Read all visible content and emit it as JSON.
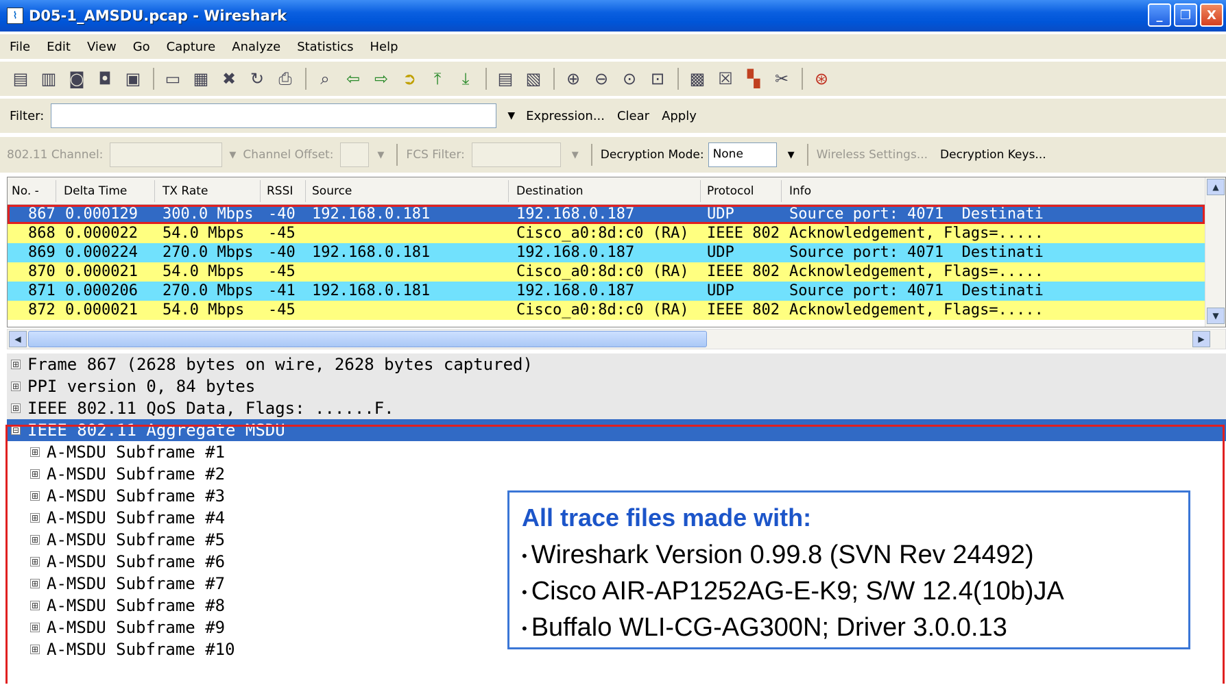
{
  "window": {
    "title": "D05-1_AMSDU.pcap - Wireshark",
    "minimize_glyph": "_",
    "maximize_glyph": "❐",
    "close_glyph": "X"
  },
  "menu": [
    "File",
    "Edit",
    "View",
    "Go",
    "Capture",
    "Analyze",
    "Statistics",
    "Help"
  ],
  "toolbar": {
    "icons": [
      "interface-list-icon",
      "capture-options-icon",
      "start-capture-icon",
      "stop-capture-icon",
      "restart-capture-icon",
      "open-file-icon",
      "save-file-icon",
      "close-file-icon",
      "reload-icon",
      "print-icon",
      "find-packet-icon",
      "go-back-icon",
      "go-forward-icon",
      "go-to-packet-icon",
      "go-first-icon",
      "go-last-icon",
      "colorize-icon",
      "auto-scroll-icon",
      "zoom-in-icon",
      "zoom-out-icon",
      "zoom-normal-icon",
      "resize-columns-icon",
      "capture-filters-icon",
      "display-filters-icon",
      "coloring-rules-icon",
      "preferences-icon",
      "help-icon"
    ]
  },
  "filter": {
    "label": "Filter:",
    "value": "",
    "expression": "Expression...",
    "clear": "Clear",
    "apply": "Apply"
  },
  "wireless": {
    "channel_label": "802.11 Channel:",
    "offset_label": "Channel Offset:",
    "fcs_label": "FCS Filter:",
    "decryption_label": "Decryption Mode:",
    "decryption_value": "None",
    "settings": "Wireless Settings...",
    "keys": "Decryption Keys..."
  },
  "packet_list": {
    "columns": [
      "No. -",
      "Delta Time",
      "TX Rate",
      "RSSI",
      "Source",
      "Destination",
      "Protocol",
      "Info"
    ],
    "rows": [
      {
        "no": "867",
        "delta": "0.000129",
        "rate": "300.0 Mbps",
        "rssi": "-40",
        "src": "192.168.0.181",
        "dst": "192.168.0.187",
        "proto": "UDP",
        "info": "Source port: 4071  Destinati",
        "style": "selected"
      },
      {
        "no": "868",
        "delta": "0.000022",
        "rate": "54.0 Mbps",
        "rssi": "-45",
        "src": "",
        "dst": "Cisco_a0:8d:c0 (RA)",
        "proto": "IEEE 802",
        "info": "Acknowledgement, Flags=.....",
        "style": "yellow"
      },
      {
        "no": "869",
        "delta": "0.000224",
        "rate": "270.0 Mbps",
        "rssi": "-40",
        "src": "192.168.0.181",
        "dst": "192.168.0.187",
        "proto": "UDP",
        "info": "Source port: 4071  Destinati",
        "style": "cyan"
      },
      {
        "no": "870",
        "delta": "0.000021",
        "rate": "54.0 Mbps",
        "rssi": "-45",
        "src": "",
        "dst": "Cisco_a0:8d:c0 (RA)",
        "proto": "IEEE 802",
        "info": "Acknowledgement, Flags=.....",
        "style": "yellow"
      },
      {
        "no": "871",
        "delta": "0.000206",
        "rate": "270.0 Mbps",
        "rssi": "-41",
        "src": "192.168.0.181",
        "dst": "192.168.0.187",
        "proto": "UDP",
        "info": "Source port: 4071  Destinati",
        "style": "cyan"
      },
      {
        "no": "872",
        "delta": "0.000021",
        "rate": "54.0 Mbps",
        "rssi": "-45",
        "src": "",
        "dst": "Cisco_a0:8d:c0 (RA)",
        "proto": "IEEE 802",
        "info": "Acknowledgement, Flags=.....",
        "style": "yellow"
      }
    ]
  },
  "details": [
    {
      "text": "Frame 867 (2628 bytes on wire, 2628 bytes captured)",
      "expander": "⊞",
      "level": 0,
      "style": "grey"
    },
    {
      "text": "PPI version 0, 84 bytes",
      "expander": "⊞",
      "level": 0,
      "style": "grey"
    },
    {
      "text": "IEEE 802.11 QoS Data, Flags: ......F.",
      "expander": "⊞",
      "level": 0,
      "style": "grey"
    },
    {
      "text": "IEEE 802.11 Aggregate MSDU",
      "expander": "⊟",
      "level": 0,
      "style": "sel"
    },
    {
      "text": "A-MSDU Subframe #1",
      "expander": "⊞",
      "level": 1,
      "style": ""
    },
    {
      "text": "A-MSDU Subframe #2",
      "expander": "⊞",
      "level": 1,
      "style": ""
    },
    {
      "text": "A-MSDU Subframe #3",
      "expander": "⊞",
      "level": 1,
      "style": ""
    },
    {
      "text": "A-MSDU Subframe #4",
      "expander": "⊞",
      "level": 1,
      "style": ""
    },
    {
      "text": "A-MSDU Subframe #5",
      "expander": "⊞",
      "level": 1,
      "style": ""
    },
    {
      "text": "A-MSDU Subframe #6",
      "expander": "⊞",
      "level": 1,
      "style": ""
    },
    {
      "text": "A-MSDU Subframe #7",
      "expander": "⊞",
      "level": 1,
      "style": ""
    },
    {
      "text": "A-MSDU Subframe #8",
      "expander": "⊞",
      "level": 1,
      "style": ""
    },
    {
      "text": "A-MSDU Subframe #9",
      "expander": "⊞",
      "level": 1,
      "style": ""
    },
    {
      "text": "A-MSDU Subframe #10",
      "expander": "⊞",
      "level": 1,
      "style": ""
    }
  ],
  "callout": {
    "heading": "All trace files made with:",
    "items": [
      "Wireshark Version 0.99.8 (SVN Rev 24492)",
      "Cisco AIR-AP1252AG-E-K9; S/W 12.4(10b)JA",
      "Buffalo WLI-CG-AG300N; Driver 3.0.0.13"
    ]
  },
  "colors": {
    "selection": "#316ac5",
    "udp_row": "#71e1fd",
    "ack_row": "#ffff80",
    "highlight_frame": "#e02020",
    "callout_border": "#3a76d6",
    "callout_heading": "#1c55c9"
  }
}
